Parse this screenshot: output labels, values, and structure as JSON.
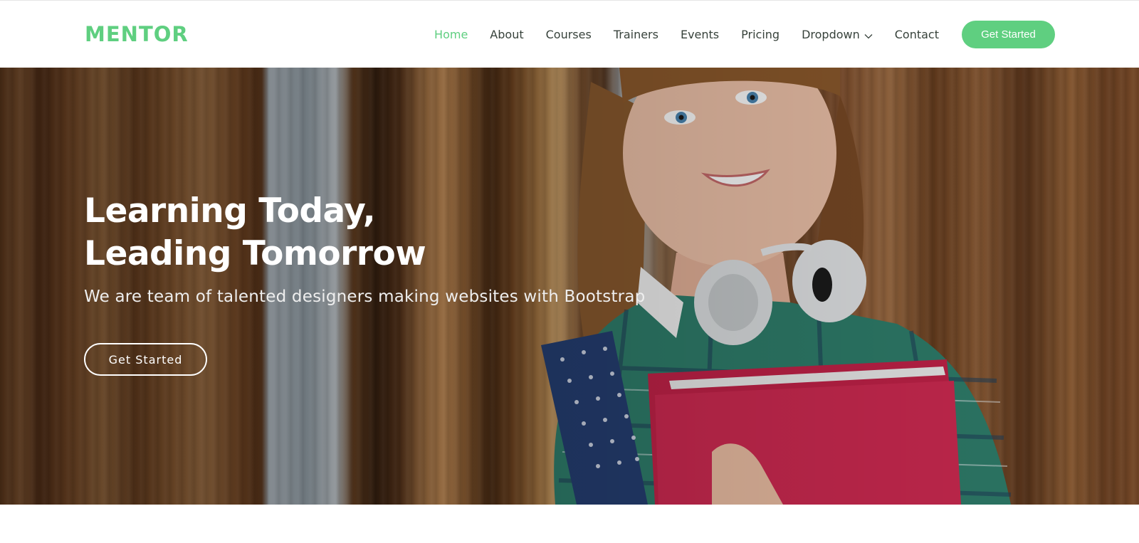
{
  "header": {
    "logo": "MENTOR",
    "nav": {
      "home": "Home",
      "about": "About",
      "courses": "Courses",
      "trainers": "Trainers",
      "events": "Events",
      "pricing": "Pricing",
      "dropdown": "Dropdown",
      "contact": "Contact"
    },
    "cta_label": "Get Started"
  },
  "hero": {
    "title_line1": "Learning Today,",
    "title_line2": "Leading Tomorrow",
    "subtitle": "We are team of talented designers making websites with Bootstrap",
    "cta_label": "Get Started"
  },
  "colors": {
    "accent": "#5fcf80",
    "nav_text": "#37423b"
  },
  "icons": {
    "dropdown_indicator": "chevron-down-icon"
  }
}
